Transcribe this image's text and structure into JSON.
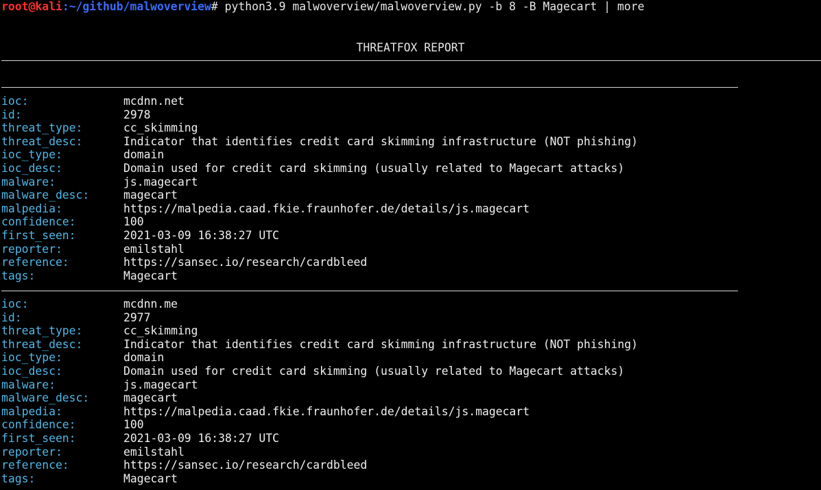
{
  "prompt": {
    "user_host": "root@kali",
    "separator": ":",
    "path": "~/github/malwoverview",
    "symbol": "#",
    "command": " python3.9 malwoverview/malwoverview.py -b 8 -B Magecart | more"
  },
  "report": {
    "title": "THREATFOX REPORT"
  },
  "records": [
    {
      "fields": [
        {
          "key": "ioc:",
          "value": "mcdnn.net"
        },
        {
          "key": "id:",
          "value": "2978"
        },
        {
          "key": "threat_type:",
          "value": "cc_skimming"
        },
        {
          "key": "threat_desc:",
          "value": "Indicator that identifies credit card skimming infrastructure (NOT phishing)"
        },
        {
          "key": "ioc_type:",
          "value": "domain"
        },
        {
          "key": "ioc_desc:",
          "value": "Domain used for credit card skimming (usually related to Magecart attacks)"
        },
        {
          "key": "malware:",
          "value": "js.magecart"
        },
        {
          "key": "malware_desc:",
          "value": "magecart"
        },
        {
          "key": "malpedia:",
          "value": "https://malpedia.caad.fkie.fraunhofer.de/details/js.magecart"
        },
        {
          "key": "confidence:",
          "value": "100"
        },
        {
          "key": "first_seen:",
          "value": "2021-03-09 16:38:27 UTC"
        },
        {
          "key": "reporter:",
          "value": "emilstahl"
        },
        {
          "key": "reference:",
          "value": "https://sansec.io/research/cardbleed"
        },
        {
          "key": "tags:",
          "value": "Magecart"
        }
      ]
    },
    {
      "fields": [
        {
          "key": "ioc:",
          "value": "mcdnn.me"
        },
        {
          "key": "id:",
          "value": "2977"
        },
        {
          "key": "threat_type:",
          "value": "cc_skimming"
        },
        {
          "key": "threat_desc:",
          "value": "Indicator that identifies credit card skimming infrastructure (NOT phishing)"
        },
        {
          "key": "ioc_type:",
          "value": "domain"
        },
        {
          "key": "ioc_desc:",
          "value": "Domain used for credit card skimming (usually related to Magecart attacks)"
        },
        {
          "key": "malware:",
          "value": "js.magecart"
        },
        {
          "key": "malware_desc:",
          "value": "magecart"
        },
        {
          "key": "malpedia:",
          "value": "https://malpedia.caad.fkie.fraunhofer.de/details/js.magecart"
        },
        {
          "key": "confidence:",
          "value": "100"
        },
        {
          "key": "first_seen:",
          "value": "2021-03-09 16:38:27 UTC"
        },
        {
          "key": "reporter:",
          "value": "emilstahl"
        },
        {
          "key": "reference:",
          "value": "https://sansec.io/research/cardbleed"
        },
        {
          "key": "tags:",
          "value": "Magecart"
        }
      ]
    }
  ],
  "colors": {
    "background": "#000000",
    "key": "#4fb8e8",
    "value": "#f0f0f0",
    "prompt_user": "#ff2f2f",
    "prompt_path": "#3a6bff"
  }
}
